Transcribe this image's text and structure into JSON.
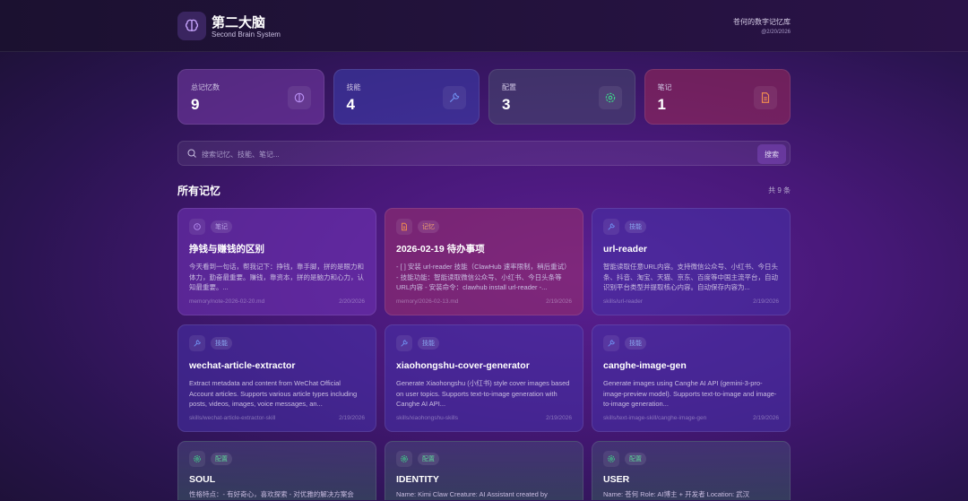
{
  "header": {
    "title": "第二大脑",
    "subtitle": "Second Brain System",
    "right_title": "苍何的数字记忆库",
    "right_date": "@2/20/2026"
  },
  "stats": [
    {
      "label": "总记忆数",
      "value": "9",
      "icon": "brain-icon",
      "color": "#b58cf0"
    },
    {
      "label": "技能",
      "value": "4",
      "icon": "wrench-icon",
      "color": "#6f8ff0"
    },
    {
      "label": "配置",
      "value": "3",
      "icon": "gear-icon",
      "color": "#3fd08a"
    },
    {
      "label": "笔记",
      "value": "1",
      "icon": "document-icon",
      "color": "#f08a50"
    }
  ],
  "search": {
    "placeholder": "搜索记忆、技能、笔记...",
    "button": "搜索"
  },
  "section": {
    "title": "所有记忆",
    "count": "共 9 条"
  },
  "cards": [
    {
      "type": "t-note",
      "tag": "笔记",
      "title": "挣钱与赚钱的区别",
      "desc": "今天看到一句话，帮我记下：挣钱，靠手脚，拼的是眼力和体力，勤奋最重要。赚钱，靠资本，拼的是脑力和心力，认知最重要。...",
      "path": "memory/note-2026-02-20.md",
      "date": "2/20/2026"
    },
    {
      "type": "t-mem",
      "tag": "记忆",
      "title": "2026-02-19 待办事项",
      "desc": "- [ ] 安装 url-reader 技能（ClawHub 速率限制，稍后重试） - 技能功能：智能读取微信公众号、小红书、今日头条等URL内容 - 安装命令：clawhub install url-reader -...",
      "path": "memory/2026-02-13.md",
      "date": "2/19/2026"
    },
    {
      "type": "t-skill",
      "tag": "技能",
      "title": "url-reader",
      "desc": "智能读取任意URL内容。支持微信公众号、小红书、今日头条、抖音、淘宝、天猫、京东、百度等中国主流平台，自动识别平台类型并提取核心内容。自动保存内容为...",
      "path": "skills/url-reader",
      "date": "2/19/2026"
    },
    {
      "type": "t-skill",
      "tag": "技能",
      "title": "wechat-article-extractor",
      "desc": "Extract metadata and content from WeChat Official Account articles. Supports various article types including posts, videos, images, voice messages, an...",
      "path": "skills/wechat-article-extractor-skill",
      "date": "2/19/2026"
    },
    {
      "type": "t-skill",
      "tag": "技能",
      "title": "xiaohongshu-cover-generator",
      "desc": "Generate Xiaohongshu (小红书) style cover images based on user topics. Supports text-to-image generation with Canghe AI API...",
      "path": "skills/xiaohongshu-skills",
      "date": "2/19/2026"
    },
    {
      "type": "t-skill",
      "tag": "技能",
      "title": "canghe-image-gen",
      "desc": "Generate images using Canghe AI API (gemini-3-pro-image-preview model). Supports text-to-image and image-to-image generation...",
      "path": "skills/text-image-skill/canghe-image-gen",
      "date": "2/19/2026"
    },
    {
      "type": "t-cfg",
      "tag": "配置",
      "title": "SOUL",
      "desc": "性格特点：- 有好奇心，喜欢探索 - 对优雅的解决方案会",
      "path": "",
      "date": ""
    },
    {
      "type": "t-cfg",
      "tag": "配置",
      "title": "IDENTITY",
      "desc": "Name: Kimi Claw Creature: AI Assistant created by",
      "path": "",
      "date": ""
    },
    {
      "type": "t-cfg",
      "tag": "配置",
      "title": "USER",
      "desc": "Name: 苍何 Role: AI博主 + 开发者 Location: 武汉",
      "path": "",
      "date": ""
    }
  ]
}
